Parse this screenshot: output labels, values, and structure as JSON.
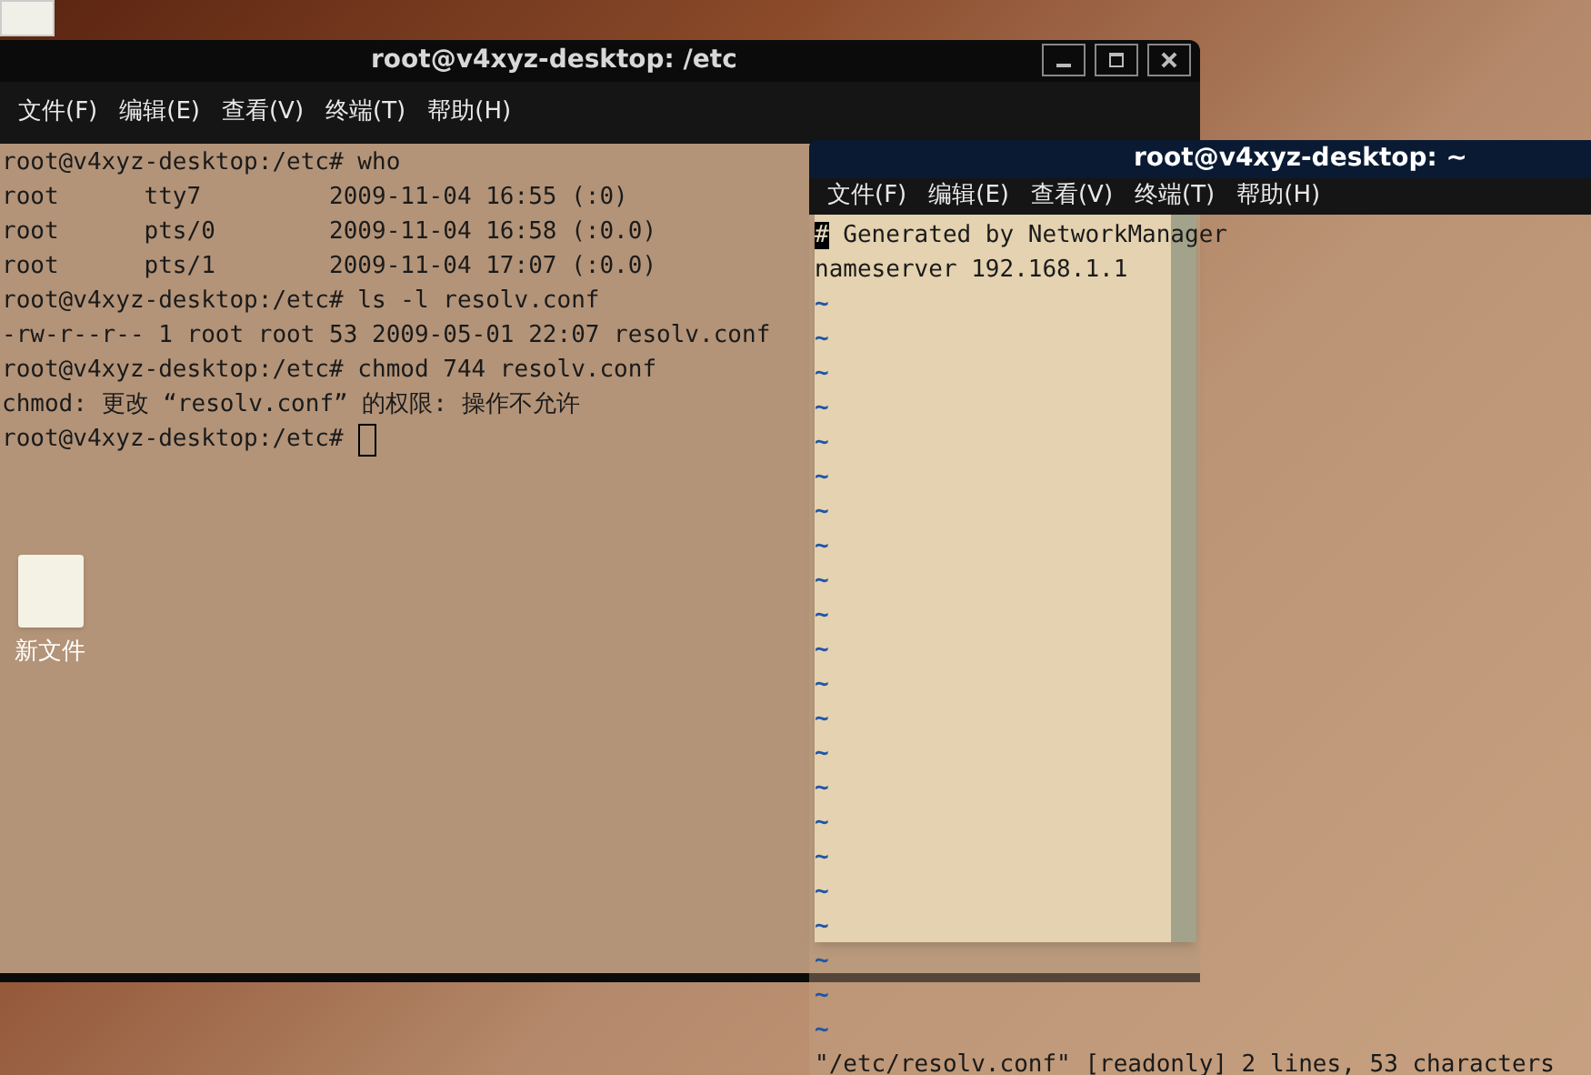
{
  "desktop_icons": [
    {
      "label": "新文件"
    }
  ],
  "windows": [
    {
      "kind": "shell",
      "title": "root@v4xyz-desktop: /etc",
      "menu": [
        "文件(F)",
        "编辑(E)",
        "查看(V)",
        "终端(T)",
        "帮助(H)"
      ],
      "lines": [
        {
          "text": "root@v4xyz-desktop:/etc# who",
          "cursor": false
        },
        {
          "text": "root      tty7         2009-11-04 16:55 (:0)",
          "cursor": false
        },
        {
          "text": "root      pts/0        2009-11-04 16:58 (:0.0)",
          "cursor": false
        },
        {
          "text": "root      pts/1        2009-11-04 17:07 (:0.0)",
          "cursor": false
        },
        {
          "text": "root@v4xyz-desktop:/etc# ls -l resolv.conf",
          "cursor": false
        },
        {
          "text": "-rw-r--r-- 1 root root 53 2009-05-01 22:07 resolv.conf",
          "cursor": false
        },
        {
          "text": "root@v4xyz-desktop:/etc# chmod 744 resolv.conf",
          "cursor": false
        },
        {
          "text": "chmod: 更改 “resolv.conf” 的权限: 操作不允许",
          "cursor": false
        },
        {
          "text": "root@v4xyz-desktop:/etc# ",
          "cursor": true
        }
      ]
    },
    {
      "kind": "vim",
      "title": "root@v4xyz-desktop: ~",
      "menu": [
        "文件(F)",
        "编辑(E)",
        "查看(V)",
        "终端(T)",
        "帮助(H)"
      ],
      "lines": [
        {
          "text": "# Generated by NetworkManager",
          "cursor": true
        },
        {
          "text": "nameserver 192.168.1.1",
          "cursor": false
        }
      ],
      "tildes": [
        "~",
        "~",
        "~",
        "~",
        "~",
        "~",
        "~",
        "~",
        "~",
        "~",
        "~",
        "~",
        "~",
        "~",
        "~",
        "~",
        "~",
        "~",
        "~",
        "~",
        "~",
        "~"
      ],
      "status": "\"/etc/resolv.conf\" [readonly] 2 lines, 53 characters"
    }
  ]
}
